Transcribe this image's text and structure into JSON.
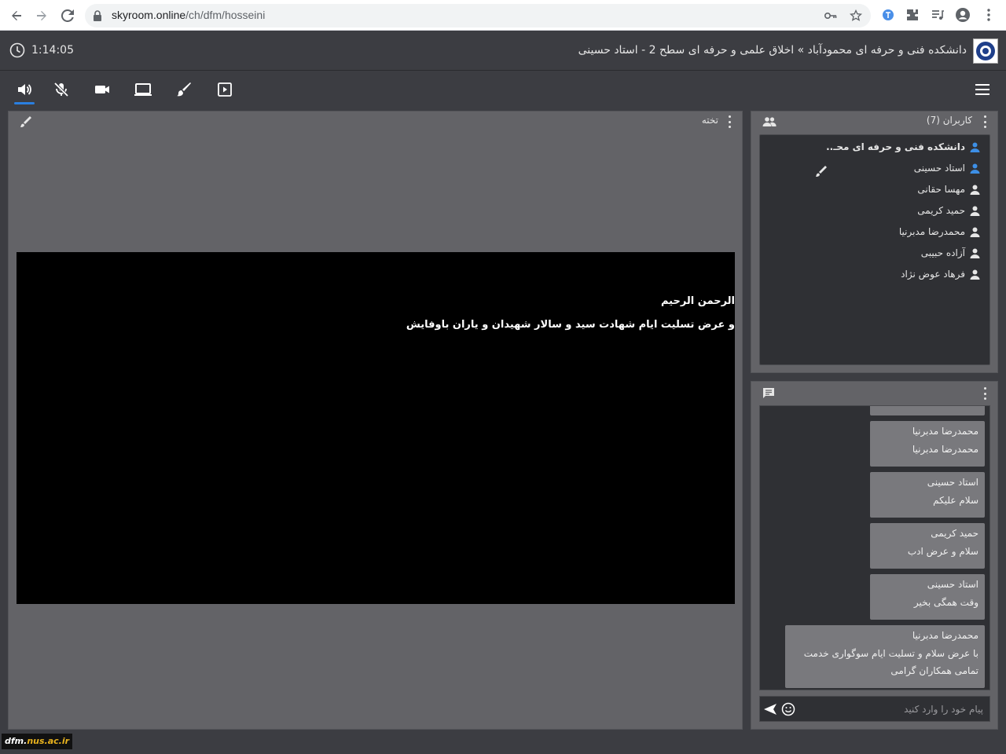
{
  "browser": {
    "url_host": "skyroom.online",
    "url_path": "/ch/dfm/hosseini"
  },
  "header": {
    "timer": "1:14:05",
    "title": "دانشکده فنی و حرفه ای محمودآباد » اخلاق علمی و حرفه ای سطح 2 - استاد حسینی"
  },
  "toolbar": {
    "items": [
      "speaker-icon",
      "mic-off-icon",
      "camera-icon",
      "screen-share-icon",
      "brush-icon",
      "presentation-icon"
    ]
  },
  "board": {
    "title": "تخته",
    "slide_lines": [
      "الرحمن الرحیم",
      "و عرض تسلیت ایام شهادت سید و سالار شهیدان و یاران باوفایش"
    ]
  },
  "users": {
    "title": "کاربران (7)",
    "list": [
      {
        "name": "دانشکده فنی و حرفه ای محـ..",
        "color": "#3d8fe6",
        "bold": true
      },
      {
        "name": "استاد حسینی",
        "color": "#3d8fe6",
        "bold": false
      },
      {
        "name": "مهسا حقانی",
        "color": "#e6e6e6",
        "bold": false
      },
      {
        "name": "حمید کریمی",
        "color": "#e6e6e6",
        "bold": false
      },
      {
        "name": "محمدرضا مدبرنیا",
        "color": "#e6e6e6",
        "bold": false
      },
      {
        "name": "آزاده حبیبی",
        "color": "#e6e6e6",
        "bold": false
      },
      {
        "name": "فرهاد عوض نژاد",
        "color": "#e6e6e6",
        "bold": false
      }
    ]
  },
  "chat": {
    "messages": [
      {
        "author": "محمدرضا مدبرنیا",
        "text": "محمدرضا مدبرنیا"
      },
      {
        "author": "استاد حسینی",
        "text": "سلام علیکم"
      },
      {
        "author": "حمید کریمی",
        "text": "سلام و عرض ادب"
      },
      {
        "author": "استاد حسینی",
        "text": "وقت همگی بخیر"
      },
      {
        "author": "محمدرضا مدبرنیا",
        "text": "با عرض سلام و تسلیت ایام سوگواری خدمت تمامی همکاران گرامی"
      }
    ],
    "input_placeholder": "پیام خود را وارد کنید"
  },
  "watermark": {
    "prefix": "dfm.",
    "suffix": "nus.ac.ir"
  }
}
